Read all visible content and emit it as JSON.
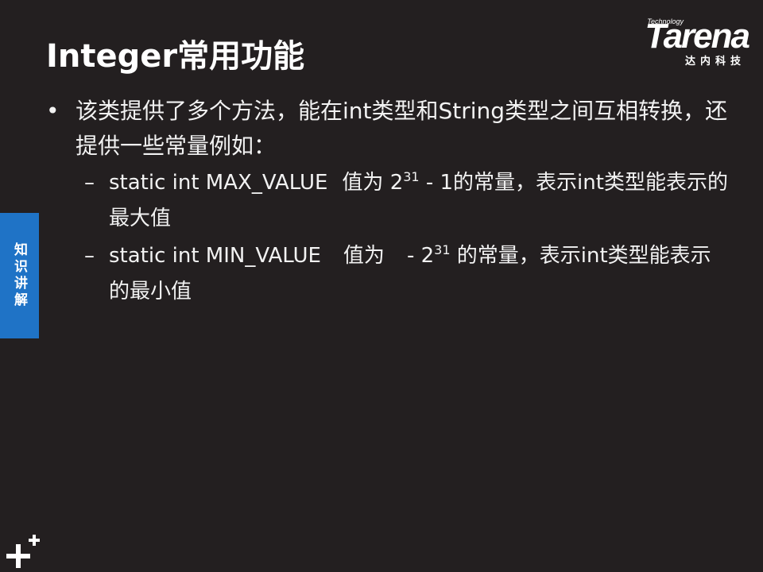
{
  "slide": {
    "title": "Integer常用功能",
    "side_tab": "知识讲解"
  },
  "logo": {
    "small": "Technology",
    "brand": "Tarena",
    "cn": "达内科技"
  },
  "content": {
    "bullet_marker": "•",
    "bullet_text": "该类提供了多个方法，能在int类型和String类型之间互相转换，还提供一些常量例如：",
    "sub_marker": "–",
    "items": [
      {
        "pre": "static int MAX_VALUE",
        "label": "值为",
        "base": "2",
        "exp": "31",
        "post": " - 1的常量，表示int类型能表示的最大值"
      },
      {
        "pre": "static int MIN_VALUE",
        "label": "值为",
        "base": "- 2",
        "exp": "31",
        "post": " 的常量，表示int类型能表示的最小值"
      }
    ]
  },
  "colors": {
    "background": "#231f20",
    "side_tab": "#1f73c6",
    "text": "#ffffff"
  }
}
